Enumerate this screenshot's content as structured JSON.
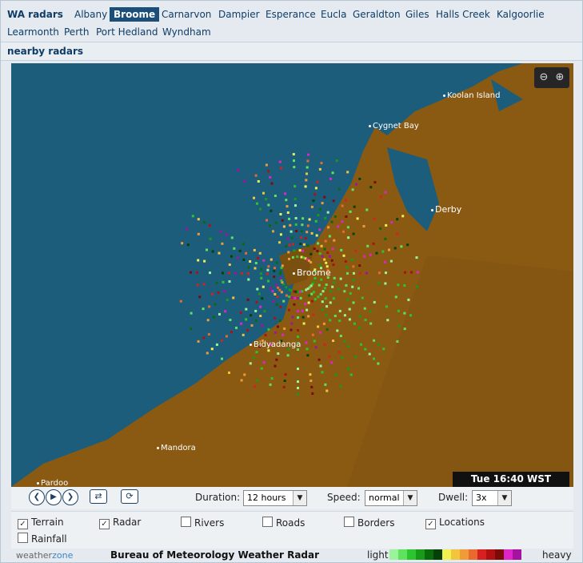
{
  "header": {
    "title": "WA radars",
    "radars": [
      {
        "label": "Albany"
      },
      {
        "label": "Broome",
        "active": true
      },
      {
        "label": "Carnarvon"
      },
      {
        "label": "Dampier"
      },
      {
        "label": "Esperance"
      },
      {
        "label": "Eucla"
      },
      {
        "label": "Geraldton"
      },
      {
        "label": "Giles"
      },
      {
        "label": "Halls Creek"
      },
      {
        "label": "Kalgoorlie"
      },
      {
        "label": "Learmonth"
      },
      {
        "label": "Perth"
      },
      {
        "label": "Port Hedland"
      },
      {
        "label": "Wyndham"
      }
    ]
  },
  "nearby": {
    "label": "nearby radars"
  },
  "map": {
    "timestamp": "Tue 16:40 WST",
    "zoom_out_icon": "zoom-out-icon",
    "zoom_in_icon": "zoom-in-icon",
    "places": [
      {
        "label": "Koolan Island"
      },
      {
        "label": "Cygnet Bay"
      },
      {
        "label": "Derby"
      },
      {
        "label": "Broome"
      },
      {
        "label": "Bidyadanga"
      },
      {
        "label": "Mandora"
      },
      {
        "label": "Pardoo"
      }
    ]
  },
  "controls": {
    "duration_label": "Duration:",
    "duration_value": "12 hours",
    "speed_label": "Speed:",
    "speed_value": "normal",
    "dwell_label": "Dwell:",
    "dwell_value": "3x",
    "icons": [
      "previous-icon",
      "play-icon",
      "next-icon",
      "swap-icon",
      "refresh-icon"
    ]
  },
  "layers": {
    "terrain": {
      "label": "Terrain",
      "checked": true
    },
    "radar": {
      "label": "Radar",
      "checked": true
    },
    "rivers": {
      "label": "Rivers",
      "checked": false
    },
    "roads": {
      "label": "Roads",
      "checked": false
    },
    "borders": {
      "label": "Borders",
      "checked": false
    },
    "locations": {
      "label": "Locations",
      "checked": true
    },
    "rainfall": {
      "label": "Rainfall",
      "checked": false
    }
  },
  "footer": {
    "brand_prefix": "weather",
    "brand_suffix": "zone",
    "source": "Bureau of Meteorology Weather Radar",
    "legend_light": "light",
    "legend_heavy": "heavy",
    "legend_colors": [
      "#9af59a",
      "#5fe35f",
      "#2dc52d",
      "#189b18",
      "#0a6a0a",
      "#054005",
      "#f1f152",
      "#f3c53a",
      "#f19a3a",
      "#e86b2d",
      "#d92020",
      "#b01010",
      "#7d0a0a",
      "#e025c8",
      "#a512a0"
    ]
  },
  "colors": {
    "sea": "#1d5d7c",
    "land": "#8a5a12",
    "accent": "#1b4f7a"
  }
}
